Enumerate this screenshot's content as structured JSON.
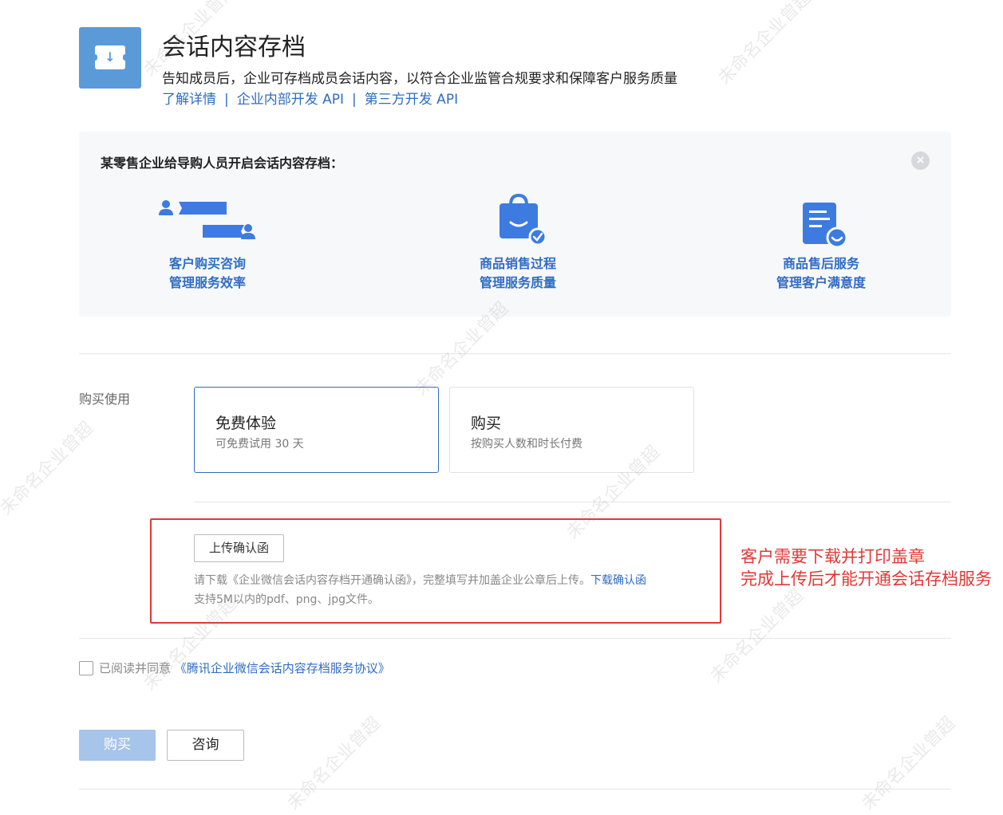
{
  "header": {
    "title": "会话内容存档",
    "description": "告知成员后，企业可存档成员会话内容，以符合企业监管合规要求和保障客户服务质量",
    "links": [
      "了解详情",
      "企业内部开发 API",
      "第三方开发 API"
    ],
    "link_separator": "|"
  },
  "example_panel": {
    "title": "某零售企业给导购人员开启会话内容存档：",
    "close_icon": "×",
    "features": [
      {
        "icon": "chat-users-icon",
        "line1": "客户购买咨询",
        "line2": "管理服务效率"
      },
      {
        "icon": "shopping-bag-check-icon",
        "line1": "商品销售过程",
        "line2": "管理服务质量"
      },
      {
        "icon": "document-smile-icon",
        "line1": "商品售后服务",
        "line2": "管理客户满意度"
      }
    ]
  },
  "purchase": {
    "label": "购买使用",
    "options": [
      {
        "title": "免费体验",
        "subtitle": "可免费试用 30 天",
        "selected": true
      },
      {
        "title": "购买",
        "subtitle": "按购买人数和时长付费",
        "selected": false
      }
    ]
  },
  "upload": {
    "button": "上传确认函",
    "note_prefix": "请下载《企业微信会话内容存档开通确认函》，完整填写并加盖企业公章后上传。",
    "note_link": "下载确认函",
    "note2": "支持5M以内的pdf、png、jpg文件。"
  },
  "annotation": {
    "line1": "客户需要下载并打印盖章",
    "line2": "完成上传后才能开通会话存档服务"
  },
  "agreement": {
    "prefix": "已阅读并同意",
    "link": "《腾讯企业微信会话内容存档服务协议》",
    "checked": false
  },
  "actions": {
    "buy": "购买",
    "consult": "咨询"
  },
  "watermark": "未命名企业曾超",
  "colors": {
    "accent": "#2f6cc4",
    "icon_blue": "#3d7be0",
    "annotation_red": "#e23838",
    "buy_disabled": "#a7c4ea"
  }
}
